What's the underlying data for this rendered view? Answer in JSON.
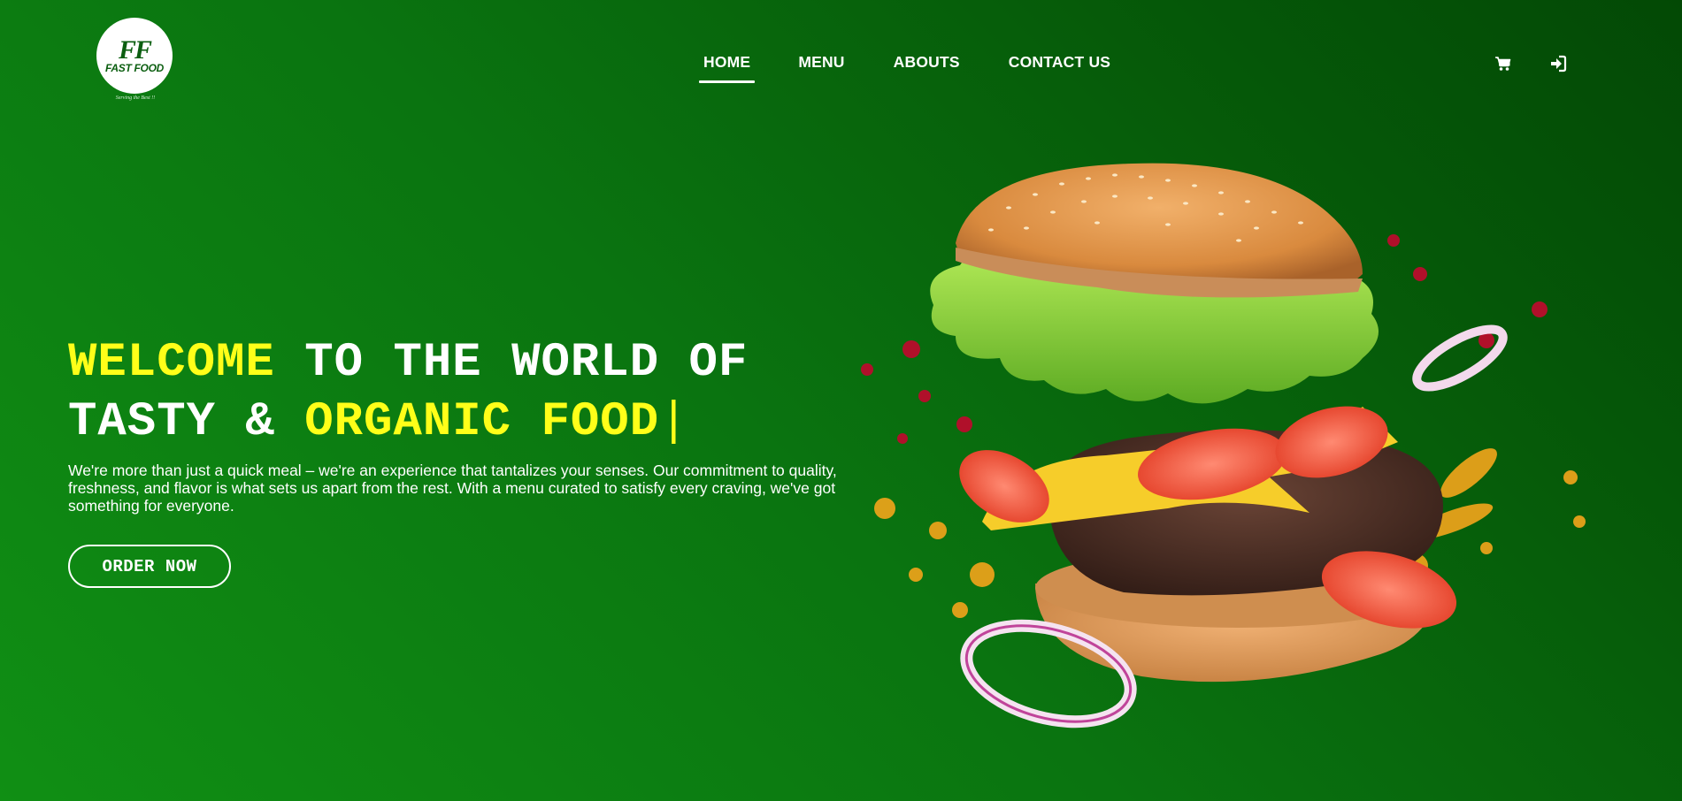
{
  "brand": {
    "logo_mark": "FF",
    "logo_name": "FAST FOOD",
    "tagline": "Serving the Best !!"
  },
  "nav": {
    "items": [
      {
        "label": "HOME",
        "active": true
      },
      {
        "label": "MENU",
        "active": false
      },
      {
        "label": "ABOUTS",
        "active": false
      },
      {
        "label": "CONTACT US",
        "active": false
      }
    ],
    "icons": [
      "cart-icon",
      "login-icon"
    ]
  },
  "hero": {
    "headline": {
      "part1_highlight": "WELCOME",
      "part2": " TO THE WORLD OF",
      "part3": "TASTY & ",
      "part4_highlight": "ORGANIC FOOD",
      "cursor": "|"
    },
    "description": "We're more than just a quick meal – we're an experience that tantalizes your senses. Our commitment to quality, freshness, and flavor is what sets us apart from the rest. With a menu curated to satisfy every craving, we've got something for everyone.",
    "cta_label": "ORDER NOW"
  },
  "colors": {
    "background_start": "#108f14",
    "background_end": "#034905",
    "highlight": "#ffff19",
    "text": "#ffffff"
  }
}
